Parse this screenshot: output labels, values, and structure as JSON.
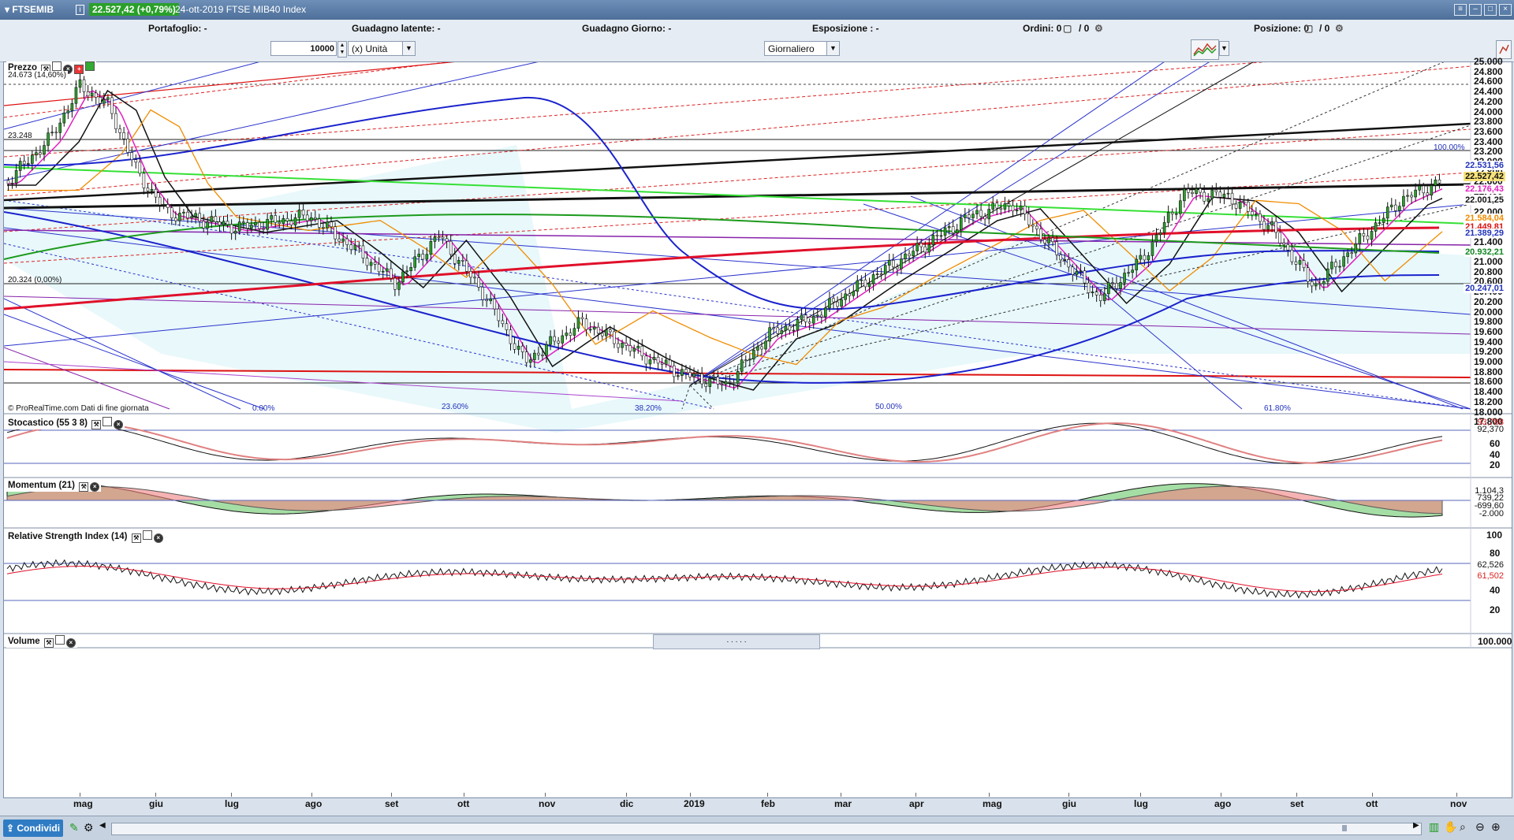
{
  "window": {
    "symbol": "▾ FTSEMIB",
    "price_badge": "22.527,42 (+0,79%)",
    "title": "24-ott-2019 FTSE MIB40 Index"
  },
  "summary": {
    "portafoglio": "Portafoglio: -",
    "guadagno_latente": "Guadagno latente: -",
    "guadagno_giorno": "Guadagno Giorno: -",
    "esposizione": "Esposizione : -",
    "ordini": "Ordini: 0",
    "ordini_count": "/ 0",
    "posizione": "Posizione: 0",
    "posizione_count": "/ 0"
  },
  "controls": {
    "quantity": "10000",
    "unit": "(x) Unità",
    "period": "Giornaliero"
  },
  "price_panel": {
    "title": "Prezzo",
    "high_label": "24.673 (14,60%)",
    "level_23248": "23.248",
    "low_label": "20.324 (0,00%)",
    "fib_labels": [
      "0.00%",
      "23.60%",
      "38.20%",
      "50.00%",
      "61.80%",
      "100.00%"
    ],
    "credit": "© ProRealTime.com  Dati di fine giornata",
    "axis": [
      "25.000",
      "24.800",
      "24.600",
      "24.400",
      "24.200",
      "24.000",
      "23.800",
      "23.600",
      "23.400",
      "23.200",
      "23.000",
      "22.800",
      "22.600",
      "22.400",
      "22.200",
      "22.000",
      "21.800",
      "21.600",
      "21.400",
      "21.200",
      "21.000",
      "20.800",
      "20.600",
      "20.400",
      "20.200",
      "20.000",
      "19.800",
      "19.600",
      "19.400",
      "19.200",
      "19.000",
      "18.800",
      "18.600",
      "18.400",
      "18.200",
      "18.000",
      "17.800"
    ],
    "tags": [
      {
        "label": "22.531,56",
        "color": "#2233bb",
        "bg": "#ffffff"
      },
      {
        "label": "22.527,42",
        "color": "#111111",
        "bg": "#f7e27a"
      },
      {
        "label": "22.176,43",
        "color": "#e020c0",
        "bg": "#ffffff"
      },
      {
        "label": "22.001,25",
        "color": "#111111",
        "bg": "#ffffff"
      },
      {
        "label": "21.584,04",
        "color": "#f08c00",
        "bg": "#ffffff"
      },
      {
        "label": "21.449,81",
        "color": "#dd1111",
        "bg": "#ffffff"
      },
      {
        "label": "21.389,29",
        "color": "#2233bb",
        "bg": "#ffffff"
      },
      {
        "label": "20.932,21",
        "color": "#118822",
        "bg": "#ffffff"
      },
      {
        "label": "20.247,01",
        "color": "#2233bb",
        "bg": "#ffffff"
      }
    ]
  },
  "stochastic": {
    "title": "Stocastico (55 3 8)",
    "tag1": "93,788",
    "tag2": "92,370",
    "axis": [
      "60",
      "40",
      "20"
    ]
  },
  "momentum": {
    "title": "Momentum (21)",
    "tag1": "1.104,3",
    "tag2": "739,22",
    "tag3": "-699,60",
    "tag4": "-2.000"
  },
  "rsi": {
    "title": "Relative Strength Index (14)",
    "tag1": "62,526",
    "tag2": "61,502",
    "axis": [
      "100",
      "80",
      "40",
      "20"
    ]
  },
  "volume": {
    "title": "Volume",
    "axis": "100.000",
    "time_bar": ".  .  .    .     ."
  },
  "time_axis": [
    "mag",
    "giu",
    "lug",
    "ago",
    "set",
    "ott",
    "nov",
    "dic",
    "2019",
    "feb",
    "mar",
    "apr",
    "mag",
    "giu",
    "lug",
    "ago",
    "set",
    "ott",
    "nov"
  ],
  "bottom": {
    "share_label": "Condividi"
  },
  "colors": {
    "candle_up": "#2aa02a",
    "candle_down": "#111111",
    "ma_red": "#e0102a",
    "ma_blue": "#1a22cc",
    "ma_green": "#1c9a1c",
    "ma_orange": "#f08c00",
    "ma_magenta": "#e020c0"
  }
}
